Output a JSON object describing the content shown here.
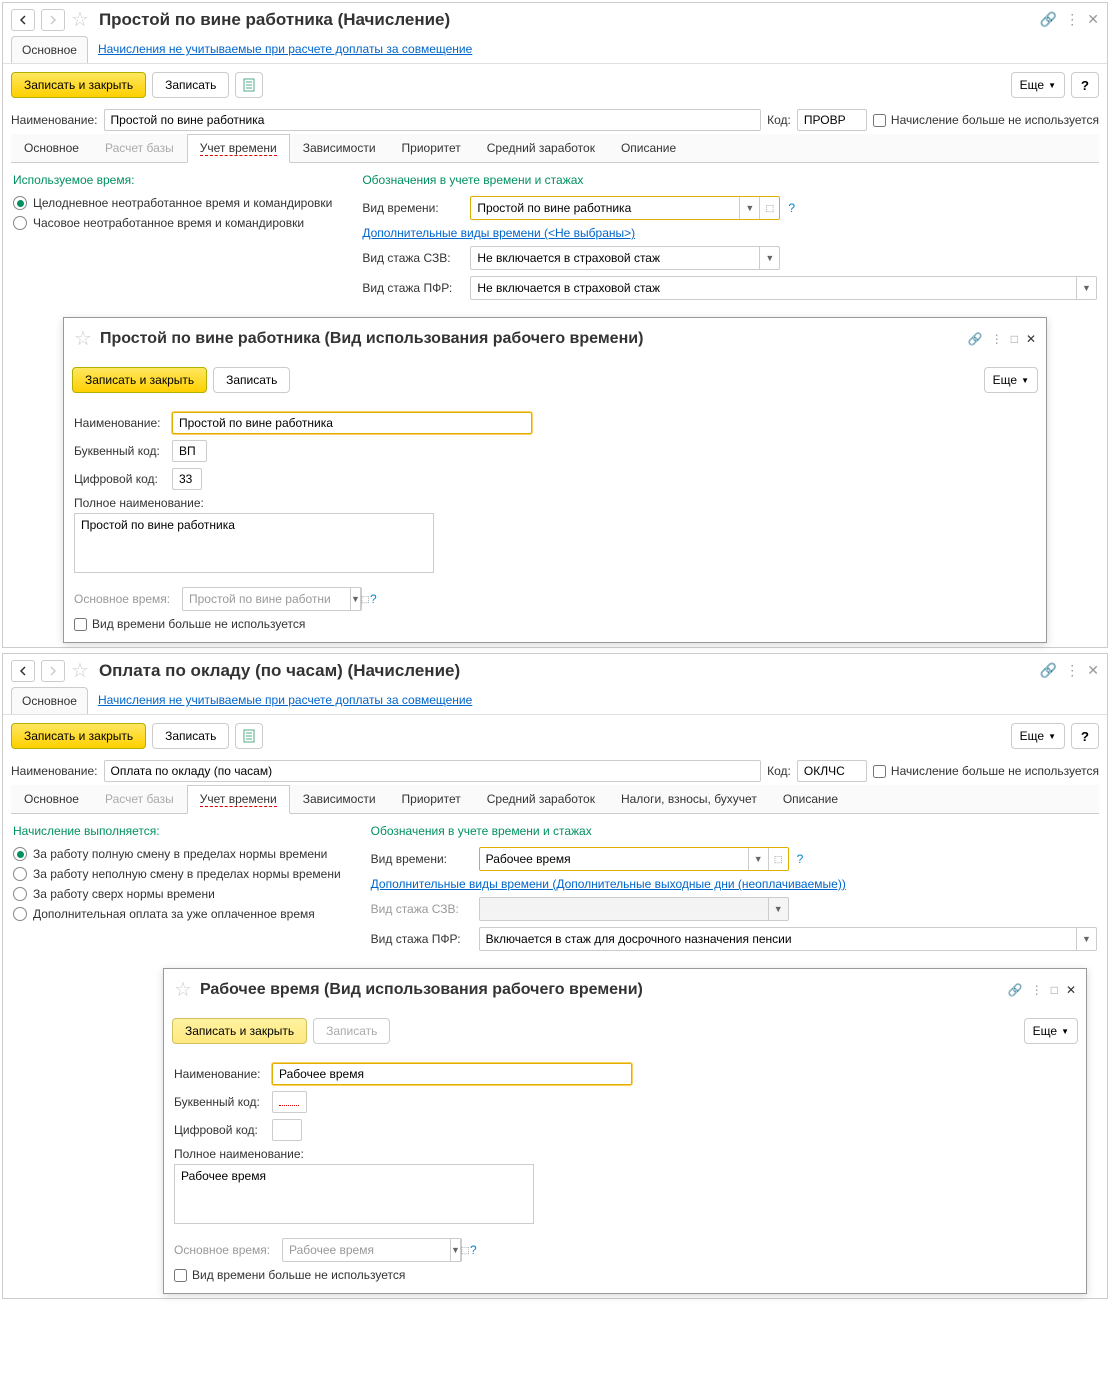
{
  "w1": {
    "title": "Простой по вине работника (Начисление)",
    "tab_main": "Основное",
    "tab_link": "Начисления не учитываемые при расчете доплаты за совмещение",
    "btn_save_close": "Записать и закрыть",
    "btn_save": "Записать",
    "btn_more": "Еще",
    "lbl_name": "Наименование:",
    "val_name": "Простой по вине работника",
    "lbl_code": "Код:",
    "val_code": "ПРОВР",
    "chk_unused": "Начисление больше не используется",
    "tabs": [
      "Основное",
      "Расчет базы",
      "Учет времени",
      "Зависимости",
      "Приоритет",
      "Средний заработок",
      "Описание"
    ],
    "left_title": "Используемое время:",
    "radio1": "Целодневное неотработанное время и командировки",
    "radio2": "Часовое неотработанное время и командировки",
    "right_title": "Обозначения в учете времени и стажах",
    "lbl_timekind": "Вид времени:",
    "val_timekind": "Простой по вине работника",
    "link_additional": "Дополнительные виды времени (<Не выбраны>)",
    "lbl_szv": "Вид стажа СЗВ:",
    "val_szv": "Не включается в страховой стаж",
    "lbl_pfr": "Вид стажа ПФР:",
    "val_pfr": "Не включается в страховой стаж"
  },
  "d1": {
    "title": "Простой по вине работника (Вид использования рабочего времени)",
    "btn_save_close": "Записать и закрыть",
    "btn_save": "Записать",
    "btn_more": "Еще",
    "lbl_name": "Наименование:",
    "val_name": "Простой по вине работника",
    "lbl_letter": "Буквенный код:",
    "val_letter": "ВП",
    "lbl_num": "Цифровой код:",
    "val_num": "33",
    "lbl_full": "Полное наименование:",
    "val_full": "Простой по вине работника",
    "lbl_base": "Основное время:",
    "val_base": "Простой по вине работни",
    "chk_unused": "Вид времени больше не используется"
  },
  "w2": {
    "title": "Оплата по окладу (по часам) (Начисление)",
    "tab_main": "Основное",
    "tab_link": "Начисления не учитываемые при расчете доплаты за совмещение",
    "btn_save_close": "Записать и закрыть",
    "btn_save": "Записать",
    "btn_more": "Еще",
    "lbl_name": "Наименование:",
    "val_name": "Оплата по окладу (по часам)",
    "lbl_code": "Код:",
    "val_code": "ОКЛЧС",
    "chk_unused": "Начисление больше не используется",
    "tabs": [
      "Основное",
      "Расчет базы",
      "Учет времени",
      "Зависимости",
      "Приоритет",
      "Средний заработок",
      "Налоги, взносы, бухучет",
      "Описание"
    ],
    "left_title": "Начисление выполняется:",
    "radio1": "За работу полную смену в пределах нормы времени",
    "radio2": "За работу неполную смену в пределах нормы времени",
    "radio3": "За работу сверх нормы времени",
    "radio4": "Дополнительная оплата за уже оплаченное время",
    "right_title": "Обозначения в учете времени и стажах",
    "lbl_timekind": "Вид времени:",
    "val_timekind": "Рабочее время",
    "link_additional": "Дополнительные виды времени (Дополнительные выходные дни (неоплачиваемые))",
    "lbl_szv": "Вид стажа СЗВ:",
    "lbl_pfr": "Вид стажа ПФР:",
    "val_pfr": "Включается в стаж для досрочного назначения пенсии"
  },
  "d2": {
    "title": "Рабочее время (Вид использования рабочего времени)",
    "btn_save_close": "Записать и закрыть",
    "btn_save": "Записать",
    "btn_more": "Еще",
    "lbl_name": "Наименование:",
    "val_name": "Рабочее время",
    "lbl_letter": "Буквенный код:",
    "lbl_num": "Цифровой код:",
    "lbl_full": "Полное наименование:",
    "val_full": "Рабочее время",
    "lbl_base": "Основное время:",
    "val_base": "Рабочее время",
    "chk_unused": "Вид времени больше не используется"
  },
  "icons": {
    "q": "?"
  }
}
